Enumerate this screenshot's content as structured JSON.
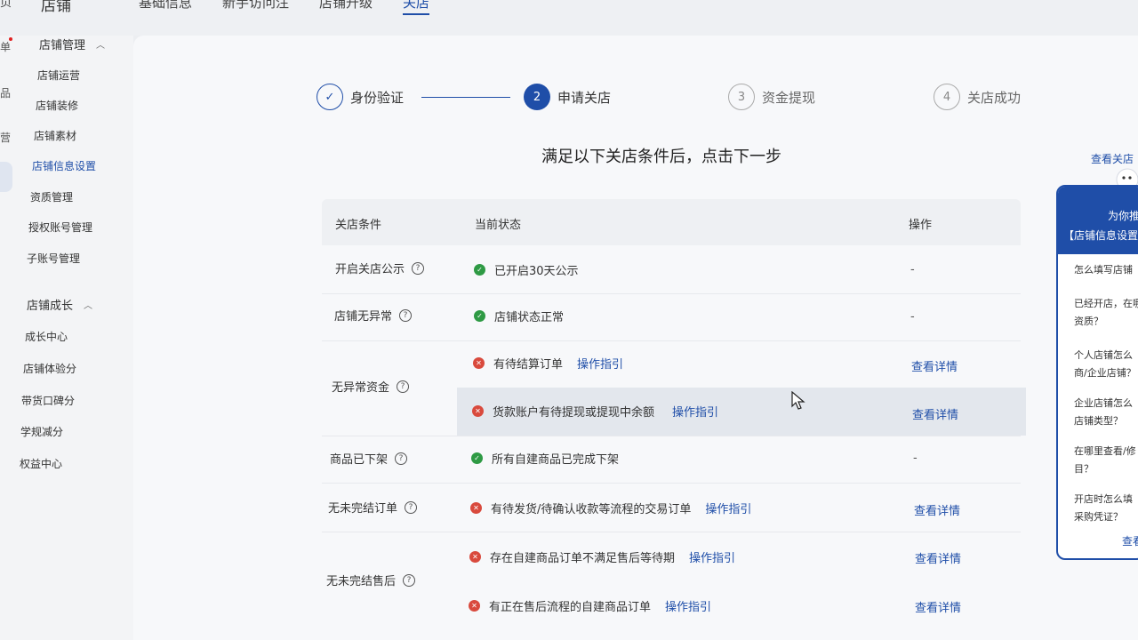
{
  "header": {
    "page_edge": "页",
    "brand": "店铺",
    "nav": [
      "基础信息",
      "新手访问注",
      "店铺升级",
      "关店"
    ],
    "active_nav": 3
  },
  "sidebar": {
    "edge_labels": [
      "单",
      "品",
      "营"
    ],
    "groups": [
      {
        "label": "店铺管理",
        "items": [
          "店铺运营",
          "店铺装修",
          "店铺素材",
          "店铺信息设置",
          "资质管理",
          "授权账号管理",
          "子账号管理"
        ]
      },
      {
        "label": "店铺成长",
        "items": [
          "成长中心",
          "店铺体验分",
          "带货口碑分",
          "学规减分",
          "权益中心"
        ]
      }
    ],
    "active_item": "店铺信息设置"
  },
  "steps": [
    {
      "index": "✓",
      "label": "身份验证",
      "state": "done"
    },
    {
      "index": "2",
      "label": "申请关店",
      "state": "current"
    },
    {
      "index": "3",
      "label": "资金提现",
      "state": "todo"
    },
    {
      "index": "4",
      "label": "关店成功",
      "state": "todo"
    }
  ],
  "heading": "满足以下关店条件后，点击下一步",
  "hint_link": "查看关店",
  "table": {
    "headers": {
      "condition": "关店条件",
      "status": "当前状态",
      "action": "操作"
    },
    "rows": [
      {
        "condition": "开启关店公示",
        "status": "已开启30天公示",
        "ok": true,
        "guide": "",
        "action": "-"
      },
      {
        "condition": "店铺无异常",
        "status": "店铺状态正常",
        "ok": true,
        "guide": "",
        "action": "-"
      },
      {
        "condition": "无异常资金",
        "status": "有待结算订单",
        "ok": false,
        "guide": "操作指引",
        "action": "查看详情"
      },
      {
        "condition": "",
        "status": "货款账户有待提现或提现中余额",
        "ok": false,
        "guide": "操作指引",
        "action": "查看详情"
      },
      {
        "condition": "商品已下架",
        "status": "所有自建商品已完成下架",
        "ok": true,
        "guide": "",
        "action": "-"
      },
      {
        "condition": "无未完结订单",
        "status": "有待发货/待确认收款等流程的交易订单",
        "ok": false,
        "guide": "操作指引",
        "action": "查看详情"
      },
      {
        "condition": "无未完结售后",
        "status": "存在自建商品订单不满足售后等待期",
        "ok": false,
        "guide": "操作指引",
        "action": "查看详情"
      },
      {
        "condition": "",
        "status": "有正在售后流程的自建商品订单",
        "ok": false,
        "guide": "操作指引",
        "action": "查看详情"
      }
    ]
  },
  "help": {
    "title": "为你推",
    "subtitle": "【店铺信息设置",
    "questions": [
      [
        "怎么填写店铺"
      ],
      [
        "已经开店，在哪",
        "资质？"
      ],
      [
        "个人店铺怎么",
        "商/企业店铺？"
      ],
      [
        "企业店铺怎么",
        "店铺类型？"
      ],
      [
        "在哪里查看/修",
        "目？"
      ],
      [
        "开店时怎么填",
        "采购凭证？"
      ]
    ],
    "more": "查看"
  },
  "icons": {
    "question": "question-circle-icon",
    "ok": "check-circle-icon",
    "error": "close-circle-icon",
    "chevron": "chevron-up-icon"
  },
  "colors": {
    "accent": "#1f4ea8",
    "ok": "#2e9a44",
    "error": "#d94a3d"
  }
}
